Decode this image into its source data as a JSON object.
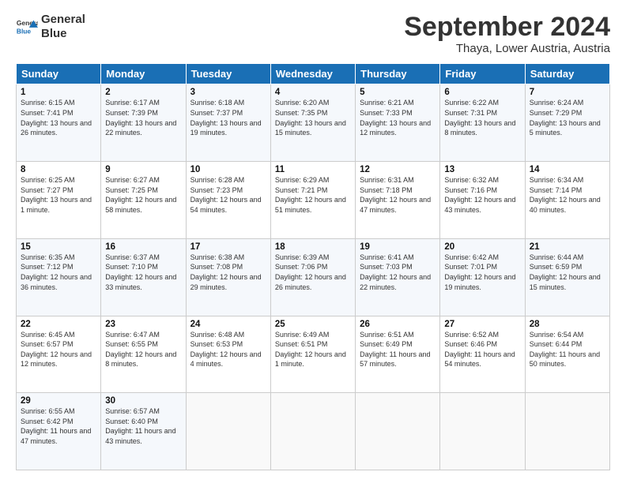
{
  "header": {
    "logo_line1": "General",
    "logo_line2": "Blue",
    "month": "September 2024",
    "location": "Thaya, Lower Austria, Austria"
  },
  "weekdays": [
    "Sunday",
    "Monday",
    "Tuesday",
    "Wednesday",
    "Thursday",
    "Friday",
    "Saturday"
  ],
  "weeks": [
    [
      {
        "day": "1",
        "sunrise": "Sunrise: 6:15 AM",
        "sunset": "Sunset: 7:41 PM",
        "daylight": "Daylight: 13 hours and 26 minutes."
      },
      {
        "day": "2",
        "sunrise": "Sunrise: 6:17 AM",
        "sunset": "Sunset: 7:39 PM",
        "daylight": "Daylight: 13 hours and 22 minutes."
      },
      {
        "day": "3",
        "sunrise": "Sunrise: 6:18 AM",
        "sunset": "Sunset: 7:37 PM",
        "daylight": "Daylight: 13 hours and 19 minutes."
      },
      {
        "day": "4",
        "sunrise": "Sunrise: 6:20 AM",
        "sunset": "Sunset: 7:35 PM",
        "daylight": "Daylight: 13 hours and 15 minutes."
      },
      {
        "day": "5",
        "sunrise": "Sunrise: 6:21 AM",
        "sunset": "Sunset: 7:33 PM",
        "daylight": "Daylight: 13 hours and 12 minutes."
      },
      {
        "day": "6",
        "sunrise": "Sunrise: 6:22 AM",
        "sunset": "Sunset: 7:31 PM",
        "daylight": "Daylight: 13 hours and 8 minutes."
      },
      {
        "day": "7",
        "sunrise": "Sunrise: 6:24 AM",
        "sunset": "Sunset: 7:29 PM",
        "daylight": "Daylight: 13 hours and 5 minutes."
      }
    ],
    [
      {
        "day": "8",
        "sunrise": "Sunrise: 6:25 AM",
        "sunset": "Sunset: 7:27 PM",
        "daylight": "Daylight: 13 hours and 1 minute."
      },
      {
        "day": "9",
        "sunrise": "Sunrise: 6:27 AM",
        "sunset": "Sunset: 7:25 PM",
        "daylight": "Daylight: 12 hours and 58 minutes."
      },
      {
        "day": "10",
        "sunrise": "Sunrise: 6:28 AM",
        "sunset": "Sunset: 7:23 PM",
        "daylight": "Daylight: 12 hours and 54 minutes."
      },
      {
        "day": "11",
        "sunrise": "Sunrise: 6:29 AM",
        "sunset": "Sunset: 7:21 PM",
        "daylight": "Daylight: 12 hours and 51 minutes."
      },
      {
        "day": "12",
        "sunrise": "Sunrise: 6:31 AM",
        "sunset": "Sunset: 7:18 PM",
        "daylight": "Daylight: 12 hours and 47 minutes."
      },
      {
        "day": "13",
        "sunrise": "Sunrise: 6:32 AM",
        "sunset": "Sunset: 7:16 PM",
        "daylight": "Daylight: 12 hours and 43 minutes."
      },
      {
        "day": "14",
        "sunrise": "Sunrise: 6:34 AM",
        "sunset": "Sunset: 7:14 PM",
        "daylight": "Daylight: 12 hours and 40 minutes."
      }
    ],
    [
      {
        "day": "15",
        "sunrise": "Sunrise: 6:35 AM",
        "sunset": "Sunset: 7:12 PM",
        "daylight": "Daylight: 12 hours and 36 minutes."
      },
      {
        "day": "16",
        "sunrise": "Sunrise: 6:37 AM",
        "sunset": "Sunset: 7:10 PM",
        "daylight": "Daylight: 12 hours and 33 minutes."
      },
      {
        "day": "17",
        "sunrise": "Sunrise: 6:38 AM",
        "sunset": "Sunset: 7:08 PM",
        "daylight": "Daylight: 12 hours and 29 minutes."
      },
      {
        "day": "18",
        "sunrise": "Sunrise: 6:39 AM",
        "sunset": "Sunset: 7:06 PM",
        "daylight": "Daylight: 12 hours and 26 minutes."
      },
      {
        "day": "19",
        "sunrise": "Sunrise: 6:41 AM",
        "sunset": "Sunset: 7:03 PM",
        "daylight": "Daylight: 12 hours and 22 minutes."
      },
      {
        "day": "20",
        "sunrise": "Sunrise: 6:42 AM",
        "sunset": "Sunset: 7:01 PM",
        "daylight": "Daylight: 12 hours and 19 minutes."
      },
      {
        "day": "21",
        "sunrise": "Sunrise: 6:44 AM",
        "sunset": "Sunset: 6:59 PM",
        "daylight": "Daylight: 12 hours and 15 minutes."
      }
    ],
    [
      {
        "day": "22",
        "sunrise": "Sunrise: 6:45 AM",
        "sunset": "Sunset: 6:57 PM",
        "daylight": "Daylight: 12 hours and 12 minutes."
      },
      {
        "day": "23",
        "sunrise": "Sunrise: 6:47 AM",
        "sunset": "Sunset: 6:55 PM",
        "daylight": "Daylight: 12 hours and 8 minutes."
      },
      {
        "day": "24",
        "sunrise": "Sunrise: 6:48 AM",
        "sunset": "Sunset: 6:53 PM",
        "daylight": "Daylight: 12 hours and 4 minutes."
      },
      {
        "day": "25",
        "sunrise": "Sunrise: 6:49 AM",
        "sunset": "Sunset: 6:51 PM",
        "daylight": "Daylight: 12 hours and 1 minute."
      },
      {
        "day": "26",
        "sunrise": "Sunrise: 6:51 AM",
        "sunset": "Sunset: 6:49 PM",
        "daylight": "Daylight: 11 hours and 57 minutes."
      },
      {
        "day": "27",
        "sunrise": "Sunrise: 6:52 AM",
        "sunset": "Sunset: 6:46 PM",
        "daylight": "Daylight: 11 hours and 54 minutes."
      },
      {
        "day": "28",
        "sunrise": "Sunrise: 6:54 AM",
        "sunset": "Sunset: 6:44 PM",
        "daylight": "Daylight: 11 hours and 50 minutes."
      }
    ],
    [
      {
        "day": "29",
        "sunrise": "Sunrise: 6:55 AM",
        "sunset": "Sunset: 6:42 PM",
        "daylight": "Daylight: 11 hours and 47 minutes."
      },
      {
        "day": "30",
        "sunrise": "Sunrise: 6:57 AM",
        "sunset": "Sunset: 6:40 PM",
        "daylight": "Daylight: 11 hours and 43 minutes."
      },
      null,
      null,
      null,
      null,
      null
    ]
  ]
}
